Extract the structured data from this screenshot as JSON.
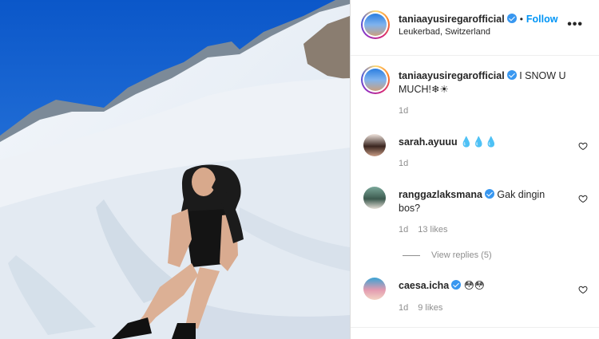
{
  "post": {
    "username": "taniaayusiregarofficial",
    "follow_label": "Follow",
    "location": "Leukerbad, Switzerland",
    "more_label": "•••",
    "separator": "•"
  },
  "caption": {
    "username": "taniaayusiregarofficial",
    "text": "I SNOW U MUCH!❄☀",
    "time": "1d"
  },
  "comments": [
    {
      "username": "sarah.ayuuu",
      "text": "💧💧💧",
      "time": "1d",
      "likes": "",
      "verified": false
    },
    {
      "username": "ranggazlaksmana",
      "text": "Gak dingin bos?",
      "time": "1d",
      "likes": "13 likes",
      "verified": true
    },
    {
      "username": "caesa.icha",
      "text": "😳😳",
      "time": "1d",
      "likes": "9 likes",
      "verified": true
    }
  ],
  "view_replies_label": "View replies (5)",
  "colors": {
    "accent": "#0095f6",
    "verified": "#3897f0",
    "sky": "#1565d8"
  }
}
